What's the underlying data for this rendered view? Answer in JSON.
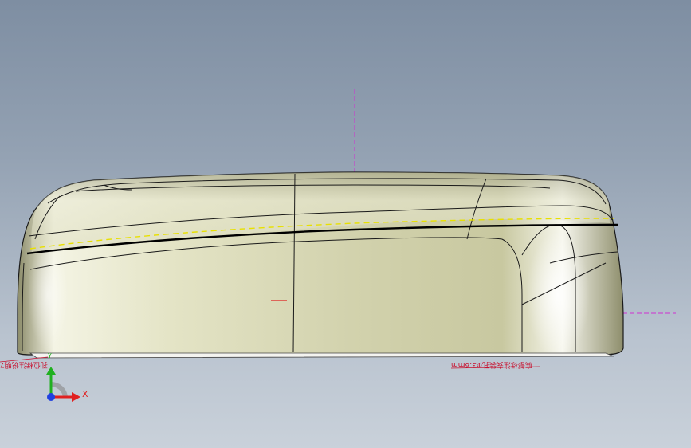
{
  "viewport": {
    "annotations": {
      "left_note": "孔位标注说明7",
      "right_note": "底部标注安装孔Φ3.6mm"
    },
    "triad": {
      "x_label": "X",
      "y_label": "Y",
      "x_color": "#e02020",
      "y_color": "#20b020",
      "z_color": "#2040e0"
    },
    "colors": {
      "construction_line": "#d030d0",
      "sketch_line": "#e8e000",
      "annotation": "#c8102e"
    }
  }
}
